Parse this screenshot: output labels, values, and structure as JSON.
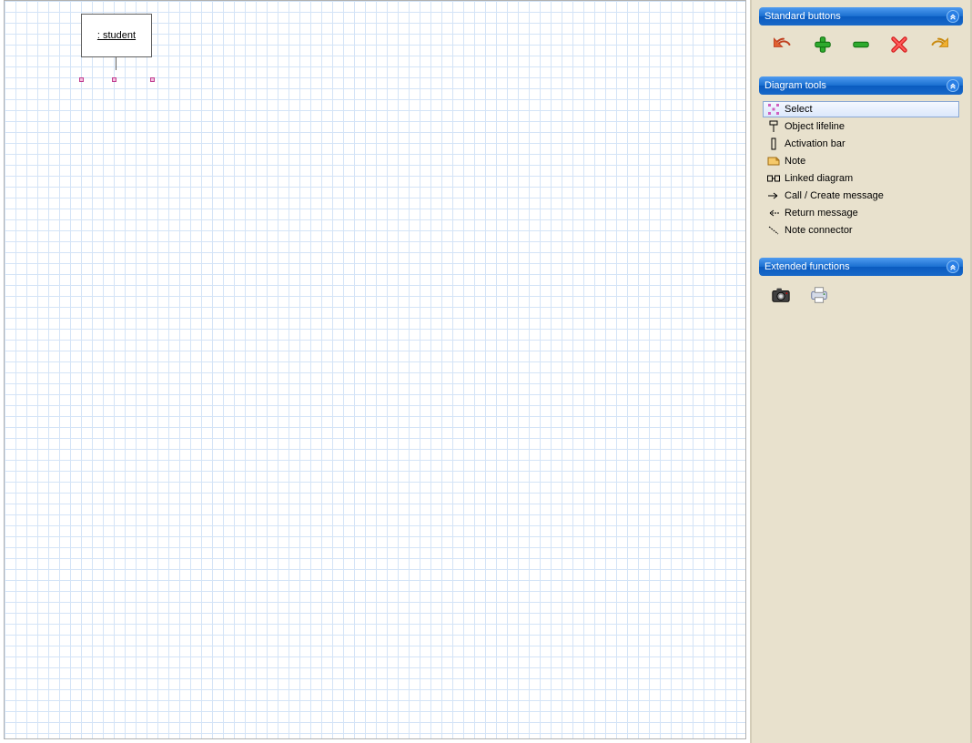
{
  "canvas": {
    "object_label": ": student"
  },
  "panels": {
    "standard": {
      "title": "Standard buttons",
      "buttons": {
        "undo": "undo",
        "add": "add",
        "remove": "remove",
        "delete": "delete",
        "redo": "redo"
      }
    },
    "tools": {
      "title": "Diagram tools",
      "items": [
        {
          "label": "Select",
          "icon": "select",
          "selected": true
        },
        {
          "label": "Object lifeline",
          "icon": "lifeline",
          "selected": false
        },
        {
          "label": "Activation bar",
          "icon": "activation",
          "selected": false
        },
        {
          "label": "Note",
          "icon": "note",
          "selected": false
        },
        {
          "label": "Linked diagram",
          "icon": "linked",
          "selected": false
        },
        {
          "label": "Call / Create message",
          "icon": "call",
          "selected": false
        },
        {
          "label": "Return message",
          "icon": "return",
          "selected": false
        },
        {
          "label": "Note connector",
          "icon": "noteconn",
          "selected": false
        }
      ]
    },
    "extended": {
      "title": "Extended functions",
      "buttons": {
        "snapshot": "snapshot",
        "print": "print"
      }
    }
  }
}
